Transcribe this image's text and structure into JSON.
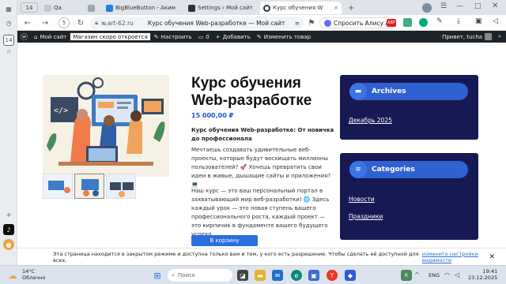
{
  "sidebar": {
    "items": [
      {
        "icon": "grid-icon"
      },
      {
        "icon": "clock-icon"
      },
      {
        "icon": "download-icon"
      },
      {
        "icon": "bookmark-icon"
      },
      {
        "icon": "screenshot-icon"
      },
      {
        "label": "14"
      },
      {
        "icon": "tiktok-icon"
      },
      {
        "icon": "add-icon"
      },
      {
        "icon": "settings-icon"
      }
    ]
  },
  "tabs": [
    {
      "label": "14"
    },
    {
      "label": "Qa"
    },
    {
      "label": "BigBlueButton - Аким"
    },
    {
      "label": "Settings ‹ Мой сайт"
    },
    {
      "label": "Курс обучения W"
    }
  ],
  "address": {
    "domain": "w.art-62.ru",
    "page_title": "Курс обучения Web-разработке — Мой сайт",
    "alice": "Спросить Алису AI"
  },
  "wpbar": {
    "site": "Мой сайт",
    "tooltip": "Магазин скоро откроется",
    "customize": "Настроить",
    "comments": "0",
    "add": "Добавить",
    "edit": "Изменить товар",
    "greeting": "Привет, tucha"
  },
  "product": {
    "title": "Курс обучения Web-разработке",
    "price": "15 000,00 ₽",
    "subtitle": "Курс обучения Web-разработке: От новичка до профессионала",
    "para1": "Мечтаешь создавать удивительные веб-проекты, которые будут восхищать миллионы пользователей? 🚀 Хочешь превратить свои идеи в живые, дышащие сайты и приложения? 💻",
    "para2": "Наш курс — это ваш персональный портал в захватывающий мир веб-разработки! 🌐 Здесь каждый урок — это новая ступень вашего профессионального роста, каждый проект — это кирпичик в фундаменте вашего будущего успеха.",
    "add_to_cart": "В корзину"
  },
  "widgets": {
    "archives": {
      "title": "Archives",
      "links": [
        "Декабрь 2025"
      ]
    },
    "categories": {
      "title": "Categories",
      "links": [
        "Новости",
        "Праздники"
      ]
    }
  },
  "cookie": {
    "text": "Эта страница находится в закрытом режиме и доступна только вам и тем, у кого есть разрешение. Чтобы сделать её доступной для всех,",
    "link": "измените настройки видимости"
  },
  "taskbar": {
    "weather_temp": "14°C",
    "weather_desc": "Облачно",
    "search_placeholder": "Поиск",
    "lang": "ENG",
    "time": "19:41",
    "date": "23.12.2025"
  },
  "colors": {
    "accent": "#2a6fde",
    "widget_bg": "#171a52",
    "wp_bar": "#1d2327"
  }
}
